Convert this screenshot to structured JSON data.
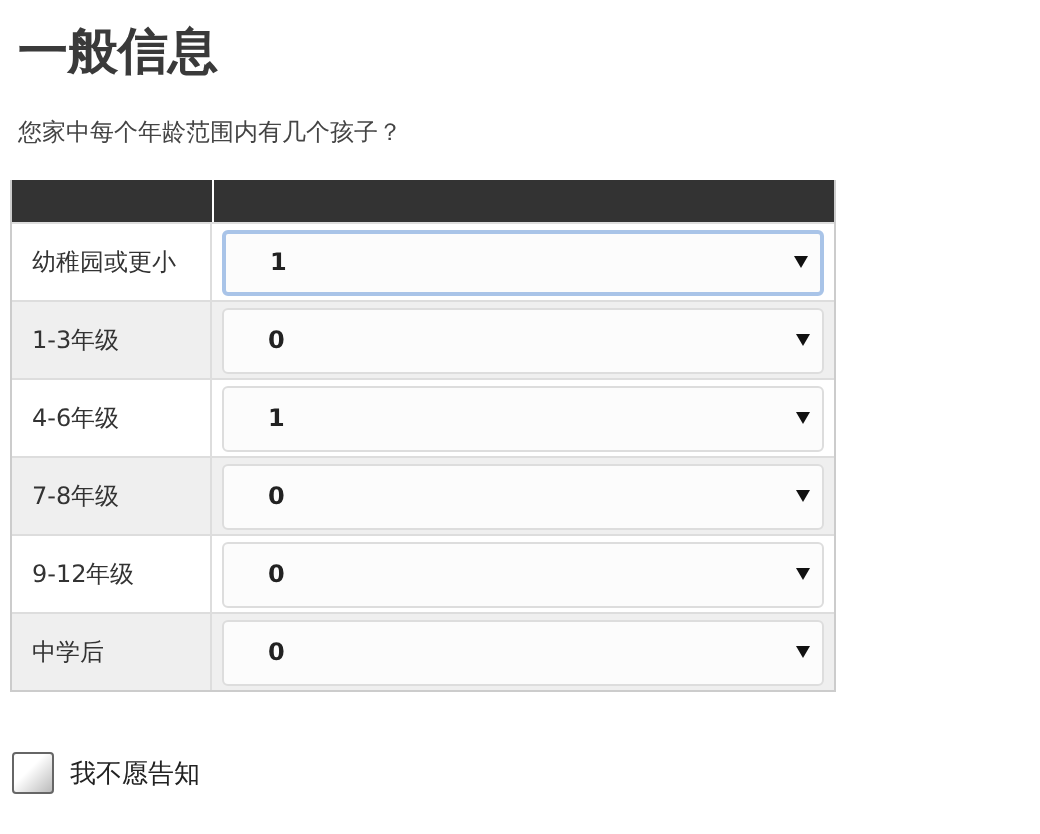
{
  "title": "一般信息",
  "question": "您家中每个年龄范围内有几个孩子？",
  "rows": [
    {
      "label": "幼稚园或更小",
      "value": "1",
      "focused": true
    },
    {
      "label": "1-3年级",
      "value": "0",
      "focused": false
    },
    {
      "label": "4-6年级",
      "value": "1",
      "focused": false
    },
    {
      "label": "7-8年级",
      "value": "0",
      "focused": false
    },
    {
      "label": "9-12年级",
      "value": "0",
      "focused": false
    },
    {
      "label": "中学后",
      "value": "0",
      "focused": false
    }
  ],
  "decline": {
    "label": "我不愿告知",
    "checked": false
  }
}
